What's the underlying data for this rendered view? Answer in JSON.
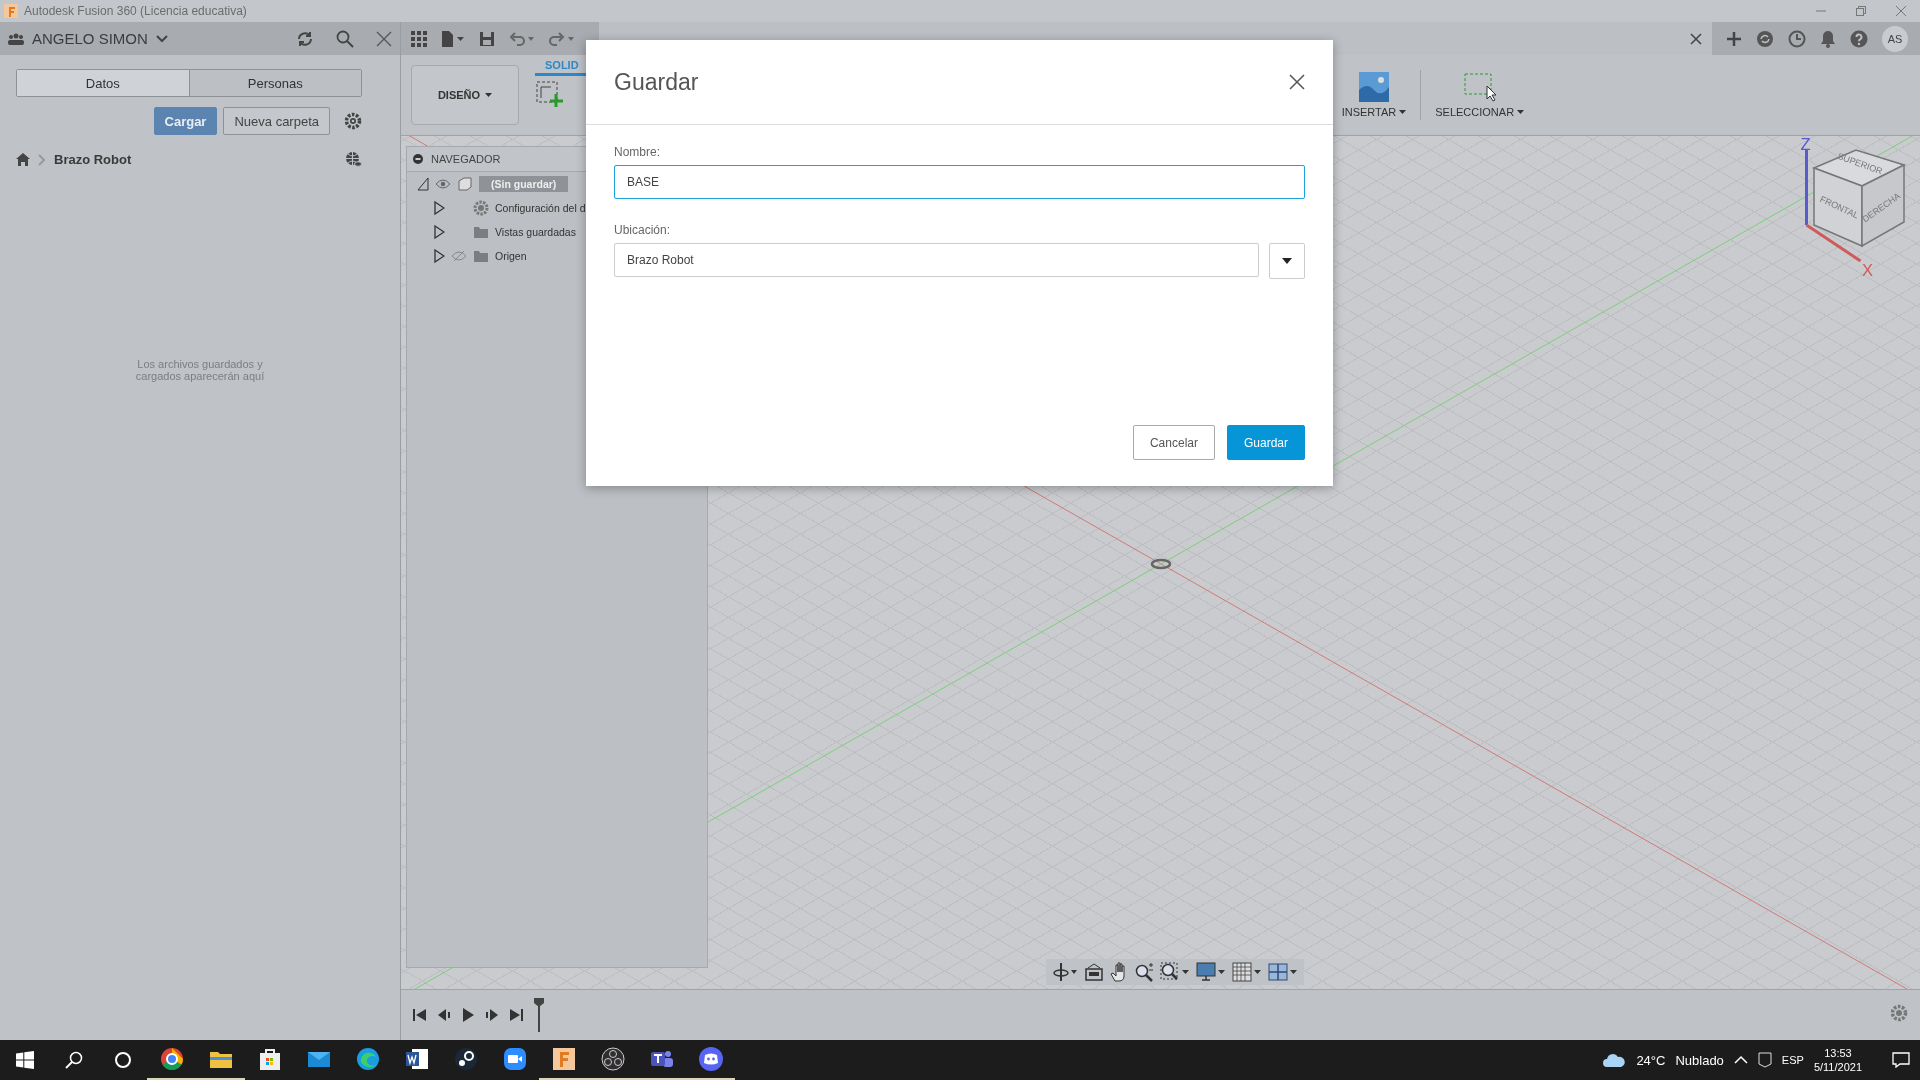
{
  "window": {
    "title": "Autodesk Fusion 360 (Licencia educativa)"
  },
  "data_panel": {
    "user": "ANGELO SIMON",
    "tabs": [
      {
        "label": "Datos",
        "selected": true
      },
      {
        "label": "Personas",
        "selected": false
      }
    ],
    "buttons": [
      {
        "label": "Cargar",
        "kind": "primary"
      },
      {
        "label": "Nueva carpeta",
        "kind": "secondary"
      }
    ],
    "breadcrumb": "Brazo Robot",
    "empty_message": "Los archivos guardados y cargados aparecerán aquí"
  },
  "user_initials": "AS",
  "ribbon": {
    "workspace": "DISEÑO",
    "tab": "SOLID",
    "groups": [
      {
        "label": "INSERTAR",
        "kind": "insert"
      },
      {
        "label": "SELECCIONAR",
        "kind": "select"
      }
    ]
  },
  "navigator": {
    "title": "NAVEGADOR",
    "tree": [
      {
        "label": "(Sin guardar)",
        "kind": "component",
        "expanded": true,
        "visible": true,
        "children": [
          {
            "label": "Configuración del d",
            "kind": "settings",
            "expanded": false
          },
          {
            "label": "Vistas guardadas",
            "kind": "folder",
            "expanded": false
          },
          {
            "label": "Origen",
            "kind": "folder",
            "expanded": false,
            "visible": false
          }
        ]
      }
    ]
  },
  "view_cube": {
    "faces": [
      "SUPERIOR",
      "FRONTAL",
      "DERECHA"
    ],
    "axes": [
      "Z",
      "X"
    ]
  },
  "dialog": {
    "title": "Guardar",
    "fields": [
      {
        "label": "Nombre:",
        "value": "BASE",
        "focused": true,
        "kind": "text"
      },
      {
        "label": "Ubicación:",
        "value": "Brazo Robot",
        "focused": false,
        "kind": "dropdown"
      }
    ],
    "buttons": [
      {
        "label": "Cancelar",
        "kind": "secondary"
      },
      {
        "label": "Guardar",
        "kind": "primary"
      }
    ]
  },
  "taskbar": {
    "apps": [
      {
        "kind": "chrome",
        "open": true
      },
      {
        "kind": "explorer",
        "open": true
      },
      {
        "kind": "store",
        "open": false
      },
      {
        "kind": "mail",
        "open": false
      },
      {
        "kind": "edge",
        "open": false
      },
      {
        "kind": "word",
        "open": false
      },
      {
        "kind": "steam",
        "open": false
      },
      {
        "kind": "zoom",
        "open": false
      },
      {
        "kind": "fusion",
        "open": true
      },
      {
        "kind": "obs",
        "open": true
      },
      {
        "kind": "teams",
        "open": true
      },
      {
        "kind": "discord",
        "open": true
      }
    ],
    "temperature": "24°C",
    "weather": "Nublado",
    "language": "ESP",
    "time": "13:53",
    "date": "5/11/2021"
  }
}
